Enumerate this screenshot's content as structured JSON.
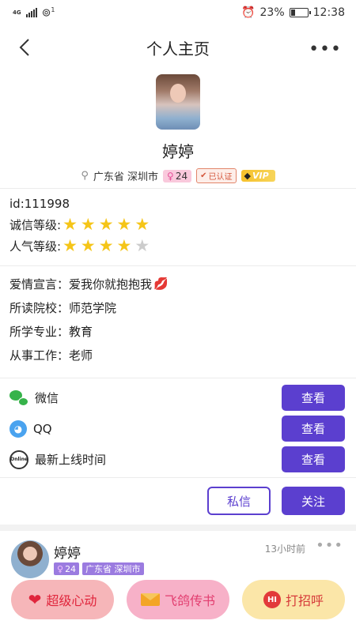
{
  "statusbar": {
    "network": "4G",
    "hotspot_count": "1",
    "alarm_icon": "alarm-icon",
    "battery_percent": "23%",
    "battery_level": 0.23,
    "time": "12:38"
  },
  "header": {
    "title": "个人主页",
    "back_icon": "back-arrow-icon",
    "more_icon": "more-icon"
  },
  "profile": {
    "name": "婷婷",
    "location": "广东省 深圳市",
    "age": "24",
    "verified_label": "已认证",
    "vip_label": "VIP"
  },
  "stats": {
    "id_text": "id:111998",
    "integrity_label": "诚信等级:",
    "integrity_stars": 5,
    "popularity_label": "人气等级:",
    "popularity_stars": 4,
    "max_stars": 5
  },
  "details": {
    "declaration": "爱情宣言：爱我你就抱抱我",
    "school": "所读院校：师范学院",
    "major": "所学专业：教育",
    "job": "从事工作：老师"
  },
  "contacts": [
    {
      "label": "微信",
      "button": "查看",
      "icon": "wechat-icon"
    },
    {
      "label": "QQ",
      "button": "查看",
      "icon": "qq-icon"
    },
    {
      "label": "最新上线时间",
      "button": "查看",
      "icon": "online-icon",
      "icon_text": "Online"
    }
  ],
  "actions": {
    "message": "私信",
    "follow": "关注"
  },
  "post": {
    "name": "婷婷",
    "age": "24",
    "location": "广东省 深圳市",
    "time": "13小时前"
  },
  "bottom_bar": {
    "super_like": "超级心动",
    "pigeon": "飞鸽传书",
    "greet": "打招呼",
    "greet_icon_text": "HI"
  },
  "colors": {
    "accent": "#5b3fcf",
    "star": "#f5c518"
  }
}
